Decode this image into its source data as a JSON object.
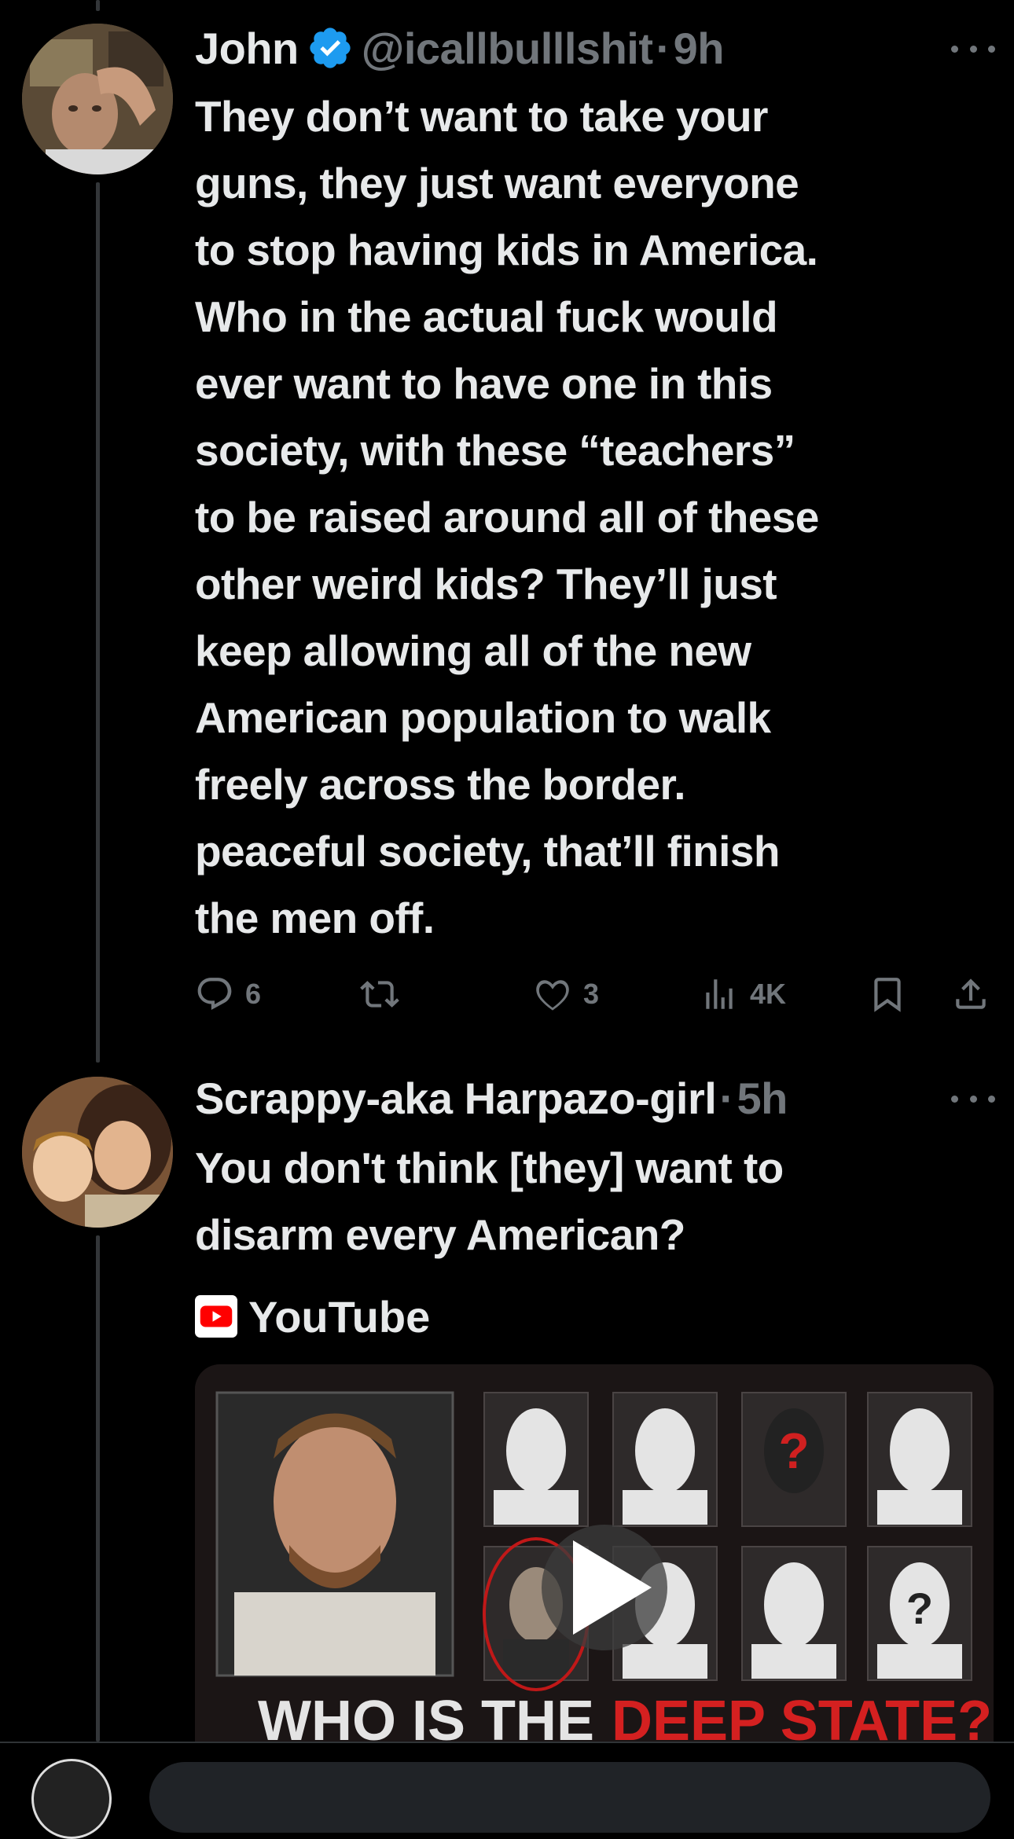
{
  "tweet1": {
    "display_name": "John",
    "handle": "@icallbulllshit",
    "separator": "·",
    "time": "9h",
    "text_lines": [
      "They don’t want to take your",
      "guns, they just want everyone",
      "to stop having kids in America.",
      "Who in the actual fuck would",
      "ever want to have one in this",
      "society, with these “teachers”",
      "to be raised around all of these",
      "other weird kids? They’ll just",
      "keep allowing all of the new",
      "American population to walk",
      "freely across the border.",
      "peaceful society, that’ll finish",
      "the men off."
    ],
    "actions": {
      "replies": "6",
      "likes": "3",
      "views": "4K"
    }
  },
  "tweet2": {
    "display_name": "Scrappy-aka Harpazo-girl",
    "separator": "·",
    "time": "5h",
    "text_lines": [
      "You don't think [they] want to",
      "disarm every American?"
    ],
    "link_source": "YouTube",
    "media": {
      "caption_visible": "WHO IS THE DEEP STATE?"
    }
  },
  "colors": {
    "background": "#000000",
    "text": "#e7e9ea",
    "muted": "#71767b",
    "verified_blue": "#1d9bf0",
    "youtube_red": "#ff0000"
  },
  "icons": [
    "more-icon",
    "verified-badge-icon",
    "reply-icon",
    "retweet-icon",
    "like-icon",
    "views-icon",
    "bookmark-icon",
    "share-icon",
    "youtube-icon",
    "play-icon"
  ]
}
